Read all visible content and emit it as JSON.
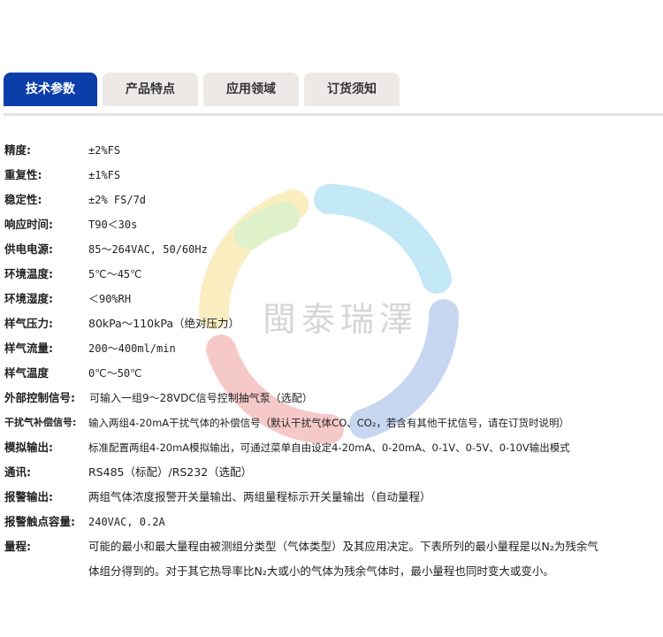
{
  "tabs": [
    {
      "label": "技术参数",
      "active": true
    },
    {
      "label": "产品特点",
      "active": false
    },
    {
      "label": "应用领域",
      "active": false
    },
    {
      "label": "订货须知",
      "active": false
    }
  ],
  "watermark": {
    "text": "閩泰瑞澤"
  },
  "colors": {
    "tab_active": "#0b3ea8",
    "tab_inactive": "#ece9e6"
  },
  "specs": [
    {
      "label": "精度:",
      "value": "±2%FS"
    },
    {
      "label": "重复性:",
      "value": "±1%FS"
    },
    {
      "label": "稳定性:",
      "value": "±2% FS/7d"
    },
    {
      "label": "响应时间:",
      "value": "T90＜30s"
    },
    {
      "label": "供电电源:",
      "value": "85～264VAC, 50/60Hz"
    },
    {
      "label": "环境温度:",
      "value": "5℃～45℃"
    },
    {
      "label": "环境湿度:",
      "value": "＜90%RH"
    },
    {
      "label": "样气压力:",
      "value": "80kPa～110kPa（绝对压力）"
    },
    {
      "label": "样气流量:",
      "value": "200～400ml/min"
    },
    {
      "label": "样气温度",
      "value": "0℃～50℃"
    },
    {
      "label": "外部控制信号:",
      "value": "可输入一组9～28VDC信号控制抽气泵（选配）"
    },
    {
      "label": "干扰气补偿信号:",
      "value": "输入两组4-20mA干扰气体的补偿信号（默认干扰气体CO、CO₂，若含有其他干扰信号，请在订货时说明）"
    },
    {
      "label": "模拟输出:",
      "value": "标准配置两组4-20mA模拟输出，可通过菜单自由设定4-20mA、0-20mA、0-1V、0-5V、0-10V输出模式"
    },
    {
      "label": "通讯:",
      "value": "RS485（标配）/RS232（选配）"
    },
    {
      "label": "报警输出:",
      "value": "两组气体浓度报警开关量输出、两组量程标示开关量输出（自动量程）"
    },
    {
      "label": "报警触点容量:",
      "value": "240VAC, 0.2A"
    }
  ],
  "range": {
    "label": "量程:",
    "line1": "可能的最小和最大量程由被测组分类型（气体类型）及其应用决定。下表所列的最小量程是以N₂为残余气",
    "line2": "体组分得到的。对于其它热导率比N₂大或小的气体为残余气体时，最小量程也同时变大或变小。"
  }
}
